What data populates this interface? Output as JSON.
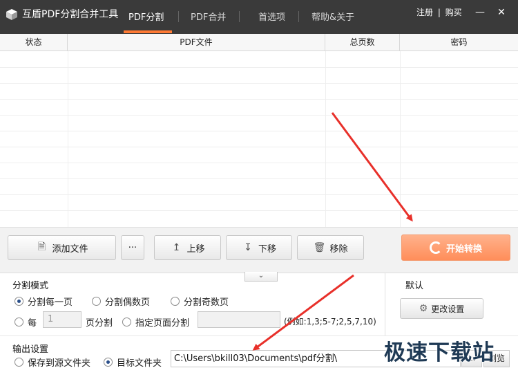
{
  "window": {
    "title": "互盾PDF分割合并工具",
    "tabs": [
      {
        "label": "PDF分割",
        "active": true
      },
      {
        "label": "PDF合并",
        "active": false
      },
      {
        "label": "首选项",
        "active": false
      },
      {
        "label": "帮助&关于",
        "active": false
      }
    ],
    "links": {
      "register": "注册",
      "separator": "|",
      "buy": "购买"
    },
    "minimize": "—",
    "close": "✕"
  },
  "table": {
    "columns": [
      "状态",
      "PDF文件",
      "总页数",
      "密码"
    ]
  },
  "toolbar": {
    "add_file": "添加文件",
    "more": "···",
    "move_up": "上移",
    "move_down": "下移",
    "remove": "移除",
    "start": "开始转换",
    "collapse": "⌄"
  },
  "split_mode": {
    "title": "分割模式",
    "options": {
      "every_page": "分割每一页",
      "even_pages": "分割偶数页",
      "odd_pages": "分割奇数页"
    },
    "every_label": "每",
    "every_value_placeholder": "1",
    "page_split_suffix": "页分割",
    "specified_pages": "指定页面分割",
    "example": "(例如:1,3;5-7;2,5,7,10)"
  },
  "default_box": {
    "title": "默认",
    "change_settings": "更改设置"
  },
  "output": {
    "title": "输出设置",
    "save_to_source": "保存到源文件夹",
    "target_folder": "目标文件夹",
    "path": "C:\\Users\\bkill03\\Documents\\pdf分割\\",
    "browse_small": "...",
    "browse_label": "浏览"
  },
  "watermark": "极速下载站",
  "colors": {
    "accent": "#ff7a34",
    "start_button": "#ff9a6a",
    "titlebar": "#3a3a3a",
    "arrow": "#e8302a"
  }
}
